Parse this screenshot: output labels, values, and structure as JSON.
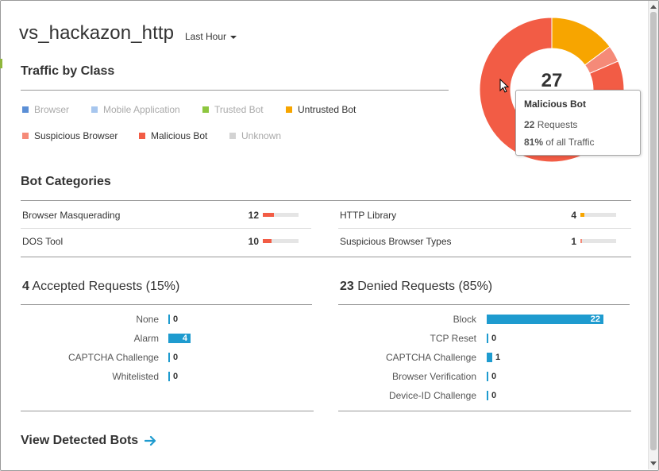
{
  "app": {
    "title": "vs_hackazon_http",
    "time_range": "Last Hour"
  },
  "traffic": {
    "title": "Traffic by Class",
    "legend": [
      {
        "label": "Browser",
        "color": "#5b8fd6",
        "active": false
      },
      {
        "label": "Mobile Application",
        "color": "#a7c6ee",
        "active": false
      },
      {
        "label": "Trusted Bot",
        "color": "#8dc63f",
        "active": false
      },
      {
        "label": "Untrusted Bot",
        "color": "#f7a500",
        "active": true
      },
      {
        "label": "Suspicious Browser",
        "color": "#f58a78",
        "active": true
      },
      {
        "label": "Malicious Bot",
        "color": "#f25c45",
        "active": true
      },
      {
        "label": "Unknown",
        "color": "#d3d3d3",
        "active": false
      }
    ],
    "total": "27",
    "chart_data": {
      "type": "pie",
      "categories": [
        "Untrusted Bot",
        "Suspicious Browser",
        "Malicious Bot"
      ],
      "values": [
        4,
        1,
        22
      ],
      "colors": [
        "#f7a500",
        "#f58a78",
        "#f25c45"
      ]
    }
  },
  "tooltip": {
    "title": "Malicious Bot",
    "requests": "22",
    "requests_label": "Requests",
    "share": "81%",
    "share_label": "of all Traffic"
  },
  "bot_categories": {
    "title": "Bot Categories",
    "items": [
      {
        "label": "Browser Masquerading",
        "count": "12",
        "value": 12,
        "color": "#f25c45"
      },
      {
        "label": "HTTP Library",
        "count": "4",
        "value": 4,
        "color": "#f7a500"
      },
      {
        "label": "DOS Tool",
        "count": "10",
        "value": 10,
        "color": "#f25c45"
      },
      {
        "label": "Suspicious Browser Types",
        "count": "1",
        "value": 1,
        "color": "#f58a78"
      }
    ]
  },
  "accepted": {
    "count": "4",
    "title": "Accepted Requests (15%)",
    "rows": [
      {
        "label": "None",
        "value": "0"
      },
      {
        "label": "Alarm",
        "value": "4"
      },
      {
        "label": "CAPTCHA Challenge",
        "value": "0"
      },
      {
        "label": "Whitelisted",
        "value": "0"
      }
    ]
  },
  "denied": {
    "count": "23",
    "title": "Denied Requests (85%)",
    "rows": [
      {
        "label": "Block",
        "value": "22"
      },
      {
        "label": "TCP Reset",
        "value": "0"
      },
      {
        "label": "CAPTCHA Challenge",
        "value": "1"
      },
      {
        "label": "Browser Verification",
        "value": "0"
      },
      {
        "label": "Device-ID Challenge",
        "value": "0"
      }
    ]
  },
  "footer": {
    "link_label": "View Detected Bots",
    "link_icon": "arrow-right-icon",
    "accent": "#1e9bcf"
  }
}
